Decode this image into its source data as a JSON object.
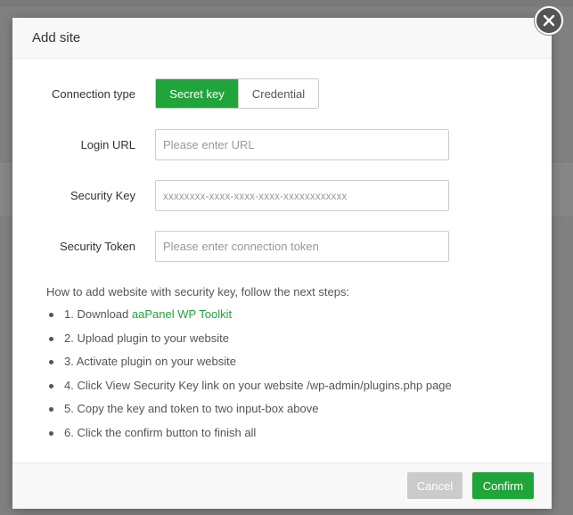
{
  "modal": {
    "title": "Add site"
  },
  "form": {
    "connection_type": {
      "label": "Connection type",
      "options": [
        "Secret key",
        "Credential"
      ],
      "selected": "Secret key"
    },
    "login_url": {
      "label": "Login URL",
      "value": "",
      "placeholder": "Please enter URL"
    },
    "security_key": {
      "label": "Security Key",
      "value": "",
      "placeholder": "xxxxxxxx-xxxx-xxxx-xxxx-xxxxxxxxxxxx"
    },
    "security_token": {
      "label": "Security Token",
      "value": "",
      "placeholder": "Please enter connection token"
    }
  },
  "instructions": {
    "intro": "How to add website with security key, follow the next steps:",
    "step1_prefix": "1. Download ",
    "step1_link": "aaPanel WP Toolkit",
    "steps": [
      "2. Upload plugin to your website",
      "3. Activate plugin on your website",
      "4. Click View Security Key link on your website /wp-admin/plugins.php page",
      "5. Copy the key and token to two input-box above",
      "6. Click the confirm button to finish all"
    ]
  },
  "footer": {
    "cancel_label": "Cancel",
    "confirm_label": "Confirm"
  },
  "colors": {
    "accent": "#20a53a",
    "cancel_disabled": "#cbcbcb",
    "close_button": "#545454"
  },
  "icons": {
    "close": "close-icon"
  }
}
